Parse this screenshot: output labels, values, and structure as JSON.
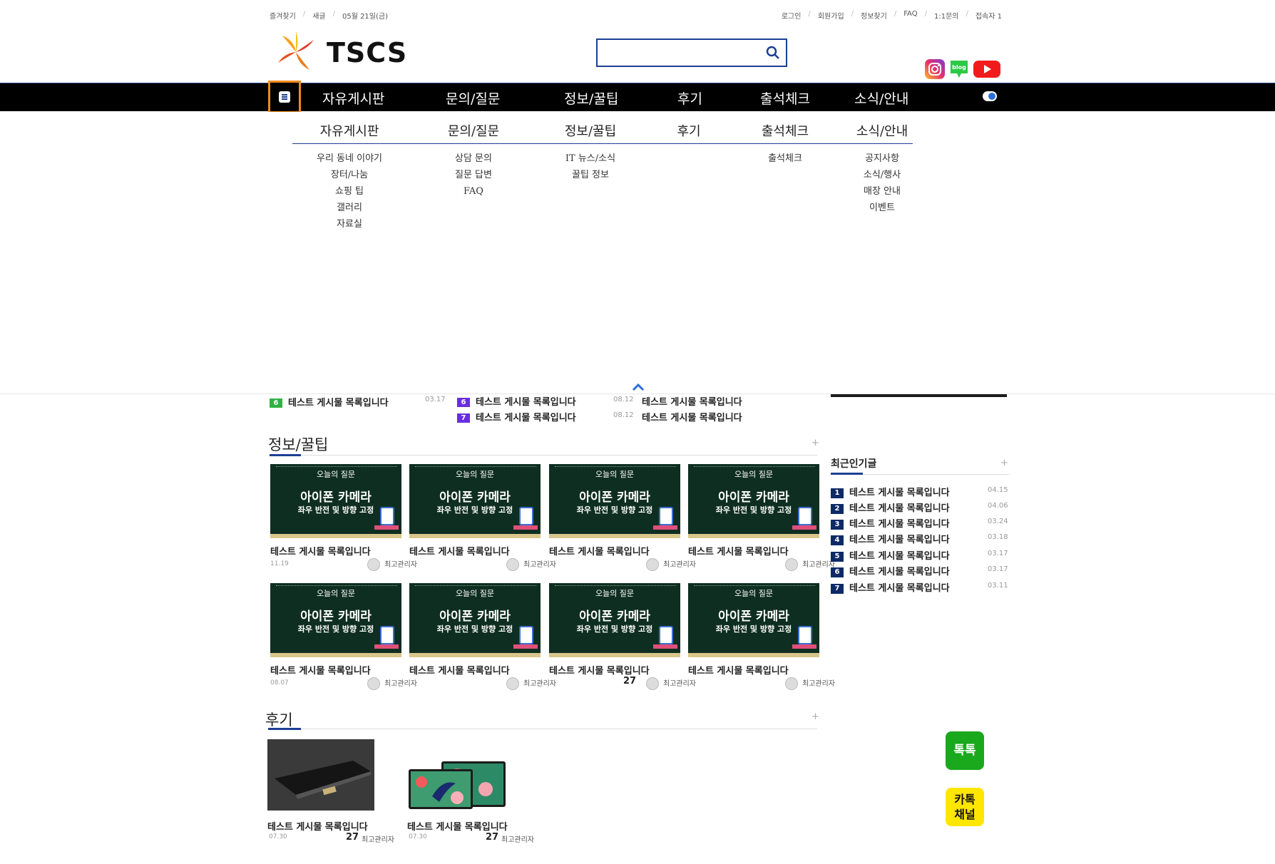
{
  "topbar": {
    "left": [
      "즐겨찾기",
      "새글",
      "05월 21일(금)"
    ],
    "right": [
      "로그인",
      "회원가입",
      "정보찾기",
      "FAQ",
      "1:1문의",
      "접속자 1"
    ]
  },
  "logo": {
    "text": "TSCS"
  },
  "search": {
    "value": "",
    "placeholder": ""
  },
  "nav": {
    "items": [
      "자유게시판",
      "문의/질문",
      "정보/꿀팁",
      "후기",
      "출석체크",
      "소식/안내"
    ]
  },
  "mega": {
    "cols": [
      {
        "head": "자유게시판",
        "subs": [
          "우리 동네 이야기",
          "장터/나눔",
          "쇼핑 팁",
          "갤러리",
          "자료실"
        ]
      },
      {
        "head": "문의/질문",
        "subs": [
          "상담 문의",
          "질문 답변",
          "FAQ"
        ]
      },
      {
        "head": "정보/꿀팁",
        "subs": [
          "IT 뉴스/소식",
          "꿀팁 정보"
        ]
      },
      {
        "head": "후기",
        "subs": []
      },
      {
        "head": "출석체크",
        "subs": [
          "출석체크"
        ]
      },
      {
        "head": "소식/안내",
        "subs": [
          "공지사항",
          "소식/행사",
          "매장 안내",
          "이벤트"
        ]
      }
    ]
  },
  "ranked": {
    "rows": [
      {
        "num": "6",
        "color": "#2fb344",
        "title": "테스트 게시물 목록입니다",
        "date": "03.17"
      },
      {
        "num": "6",
        "color": "#6a2de0",
        "title": "테스트 게시물 목록입니다",
        "date": "08.12"
      },
      {
        "num": "7",
        "color": "#6a2de0",
        "title": "테스트 게시물 목록입니다",
        "date": "08.12"
      }
    ],
    "plain": [
      "테스트 게시물 목록입니다",
      "테스트 게시물 목록입니다"
    ]
  },
  "info": {
    "title": "정보/꿀팁",
    "plus": "+",
    "thumb": {
      "q": "오늘의 질문",
      "t1": "아이폰 카메라",
      "t2": "좌우 반전 및 방향 고정"
    },
    "cards": [
      {
        "title": "테스트 게시물 목록입니다",
        "date": "11.19",
        "author": "최고관리자",
        "count": ""
      },
      {
        "title": "테스트 게시물 목록입니다",
        "date": "",
        "author": "최고관리자",
        "count": ""
      },
      {
        "title": "테스트 게시물 목록입니다",
        "date": "",
        "author": "최고관리자",
        "count": ""
      },
      {
        "title": "테스트 게시물 목록입니다",
        "date": "",
        "author": "최고관리자",
        "count": ""
      },
      {
        "title": "테스트 게시물 목록입니다",
        "date": "08.07",
        "author": "최고관리자",
        "count": ""
      },
      {
        "title": "테스트 게시물 목록입니다",
        "date": "",
        "author": "최고관리자",
        "count": ""
      },
      {
        "title": "테스트 게시물 목록입니다",
        "date": "",
        "author": "최고관리자",
        "count": "27"
      },
      {
        "title": "테스트 게시물 목록입니다",
        "date": "",
        "author": "최고관리자",
        "count": ""
      }
    ]
  },
  "review": {
    "title": "후기",
    "plus": "+",
    "items": [
      {
        "title": "테스트 게시물 목록입니다",
        "date": "07.30",
        "count": "27",
        "author": "최고관리자"
      },
      {
        "title": "테스트 게시물 목록입니다",
        "date": "07.30",
        "count": "27",
        "author": "최고관리자"
      }
    ]
  },
  "popular": {
    "title": "최근인기글",
    "plus": "+",
    "items": [
      {
        "num": "1",
        "title": "테스트 게시물 목록입니다",
        "date": "04.15"
      },
      {
        "num": "2",
        "title": "테스트 게시물 목록입니다",
        "date": "04.06"
      },
      {
        "num": "3",
        "title": "테스트 게시물 목록입니다",
        "date": "03.24"
      },
      {
        "num": "4",
        "title": "테스트 게시물 목록입니다",
        "date": "03.18"
      },
      {
        "num": "5",
        "title": "테스트 게시물 목록입니다",
        "date": "03.17"
      },
      {
        "num": "6",
        "title": "테스트 게시물 목록입니다",
        "date": "03.17"
      },
      {
        "num": "7",
        "title": "테스트 게시물 목록입니다",
        "date": "03.11"
      }
    ]
  },
  "floating": {
    "talk": "톡톡",
    "kakao_line1": "카톡",
    "kakao_line2": "채널"
  },
  "colors": {
    "accent": "#1c3f94",
    "menu_highlight": "#f08a1a",
    "talk_green": "#1aa81c",
    "kakao_yellow": "#ffe600"
  },
  "icons": [
    "search-icon",
    "menu-icon",
    "instagram-icon",
    "blog-icon",
    "youtube-icon",
    "toggle-icon",
    "chevron-up-icon"
  ]
}
